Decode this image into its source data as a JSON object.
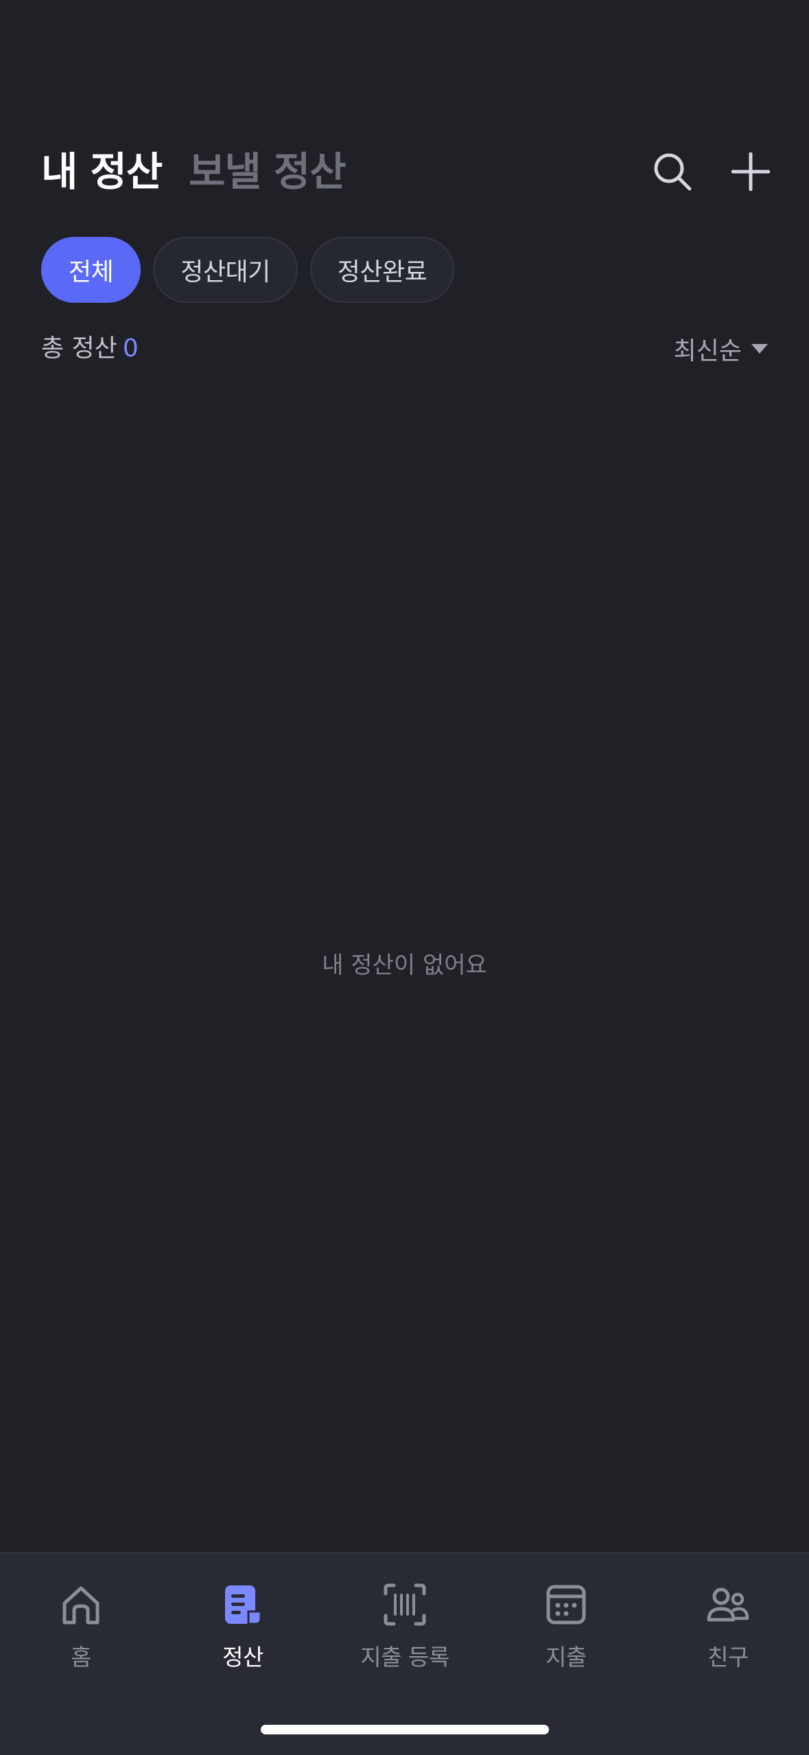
{
  "header": {
    "tab_mine": "내 정산",
    "tab_send": "보낼 정산",
    "search_icon": "search-icon",
    "add_icon": "plus-icon"
  },
  "filters": {
    "all": "전체",
    "pending": "정산대기",
    "done": "정산완료",
    "active": "전체",
    "accent_color": "#5a6af7"
  },
  "summary": {
    "total_label": "총 정산",
    "total_count": "0",
    "sort_label": "최신순"
  },
  "empty_state": {
    "message": "내 정산이 없어요"
  },
  "bottom_nav": {
    "items": [
      {
        "label": "홈",
        "icon": "home-icon"
      },
      {
        "label": "정산",
        "icon": "receipt-icon",
        "active": true
      },
      {
        "label": "지출 등록",
        "icon": "barcode-scan-icon"
      },
      {
        "label": "지출",
        "icon": "calendar-icon"
      },
      {
        "label": "친구",
        "icon": "friends-icon"
      }
    ]
  }
}
